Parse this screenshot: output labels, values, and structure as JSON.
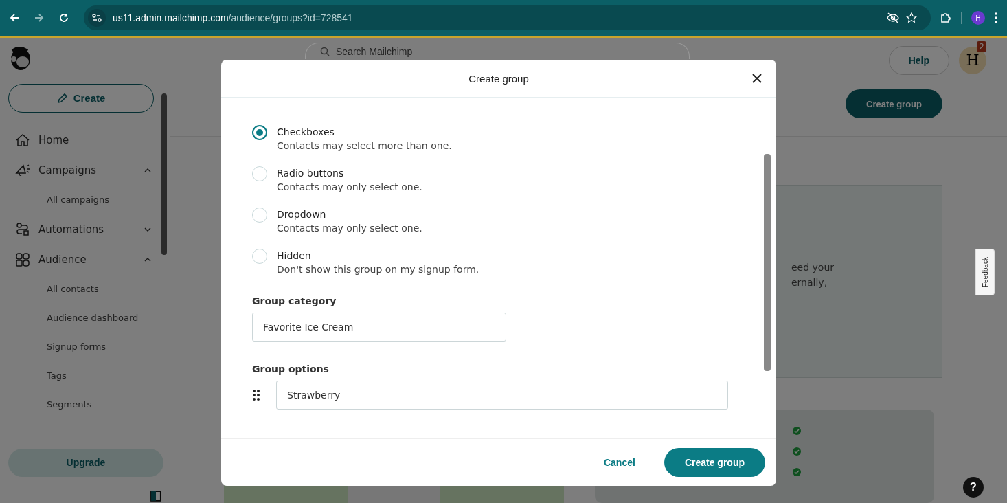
{
  "browser": {
    "url_host": "us11.admin.mailchimp.com",
    "url_path": "/audience/groups?id=728541",
    "profile_initial": "H"
  },
  "header": {
    "search_placeholder": "Search Mailchimp",
    "help": "Help",
    "avatar_letter": "H",
    "notification_count": "2"
  },
  "sidebar": {
    "create_button": "Create",
    "items": [
      {
        "label": "Home"
      },
      {
        "label": "Campaigns",
        "expanded": true,
        "children": [
          {
            "label": "All campaigns"
          }
        ]
      },
      {
        "label": "Automations",
        "expanded": false
      },
      {
        "label": "Audience",
        "expanded": true,
        "children": [
          {
            "label": "All contacts"
          },
          {
            "label": "Audience dashboard"
          },
          {
            "label": "Signup forms"
          },
          {
            "label": "Tags"
          },
          {
            "label": "Segments"
          }
        ]
      }
    ],
    "upgrade_button": "Upgrade"
  },
  "page": {
    "create_group_button": "Create group",
    "card_text_lines": [
      "eed your",
      "ernally,"
    ],
    "feedback": "Feedback",
    "help_button": "?"
  },
  "modal": {
    "title": "Create group",
    "types": [
      {
        "label": "Checkboxes",
        "description": "Contacts may select more than one.",
        "selected": true
      },
      {
        "label": "Radio buttons",
        "description": "Contacts may only select one.",
        "selected": false
      },
      {
        "label": "Dropdown",
        "description": "Contacts may only select one.",
        "selected": false
      },
      {
        "label": "Hidden",
        "description": "Don't show this group on my signup form.",
        "selected": false
      }
    ],
    "category_label": "Group category",
    "category_value": "Favorite Ice Cream",
    "options_label": "Group options",
    "option_values": [
      "Strawberry"
    ],
    "cancel": "Cancel",
    "submit": "Create group"
  }
}
